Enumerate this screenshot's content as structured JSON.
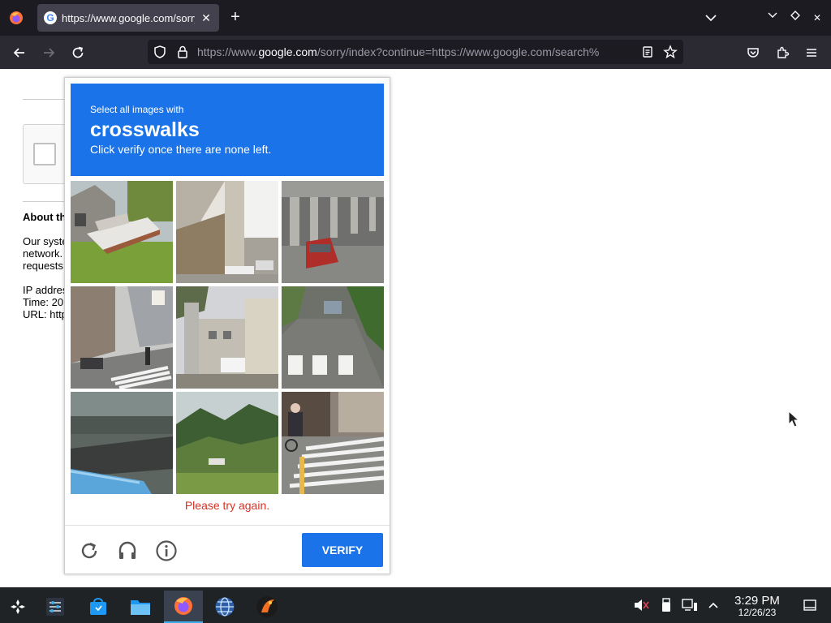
{
  "browser": {
    "tab": {
      "title": "https://www.google.com/sorry/index?continue=",
      "favicon": "google-g-icon"
    },
    "url": {
      "scheme": "https://www.",
      "host": "google.com",
      "path": "/sorry/index?continue=https://www.google.com/search%"
    }
  },
  "page": {
    "about_heading": "About th",
    "paragraph_lines": [
      "Our syste",
      "network.",
      "requests"
    ],
    "info_lines": [
      "IP addres",
      "Time: 20",
      "URL: http"
    ]
  },
  "captcha": {
    "instruction": "Select all images with",
    "target": "crosswalks",
    "hint": "Click verify once there are none left.",
    "error": "Please try again.",
    "verify_label": "VERIFY",
    "colors": {
      "accent": "#1a73e8",
      "error": "#d93025"
    },
    "tiles": [
      {
        "name": "tile-boat-lawn"
      },
      {
        "name": "tile-overpass-pillar"
      },
      {
        "name": "tile-underpass-car"
      },
      {
        "name": "tile-city-street-crosswalk"
      },
      {
        "name": "tile-building-tree"
      },
      {
        "name": "tile-road-crosswalk"
      },
      {
        "name": "tile-pool-plaza"
      },
      {
        "name": "tile-green-hills"
      },
      {
        "name": "tile-cyclist-crosswalk"
      }
    ],
    "footer_icons": [
      "reload-icon",
      "headphones-icon",
      "info-icon"
    ]
  },
  "taskbar": {
    "clock": {
      "time": "3:29 PM",
      "date": "12/26/23"
    }
  }
}
